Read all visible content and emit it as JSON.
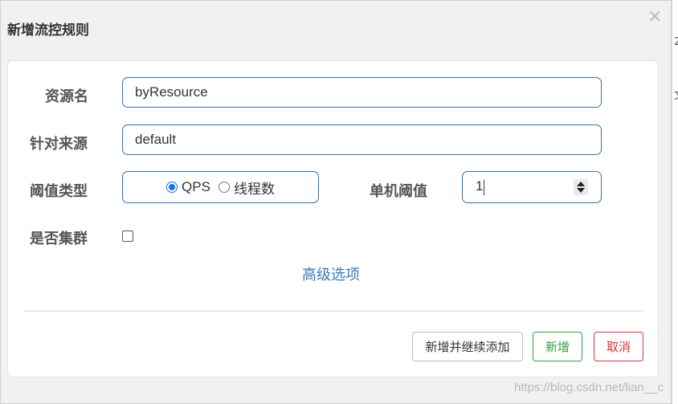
{
  "dialog": {
    "title": "新增流控规则",
    "close_icon": "×"
  },
  "form": {
    "resource_label": "资源名",
    "resource_value": "byResource",
    "source_label": "针对来源",
    "source_value": "default",
    "threshold_type_label": "阈值类型",
    "threshold_type_options": [
      "QPS",
      "线程数"
    ],
    "threshold_type_selected": "QPS",
    "single_threshold_label": "单机阈值",
    "single_threshold_value": "1",
    "cluster_label": "是否集群",
    "cluster_checked": false,
    "advanced_link": "高级选项"
  },
  "buttons": {
    "add_and_continue": "新增并继续添加",
    "add": "新增",
    "cancel": "取消"
  },
  "background_fragments": [
    "2",
    "文"
  ],
  "watermark": "https://blog.csdn.net/lian__c",
  "colors": {
    "input_border": "#3a6eae",
    "radio_checked": "#1a73e8",
    "add_button": "#2e9e44",
    "cancel_button": "#d9363e",
    "link": "#3a7ab8"
  },
  "icons": [
    "close-icon",
    "spin-up-icon",
    "spin-down-icon"
  ]
}
